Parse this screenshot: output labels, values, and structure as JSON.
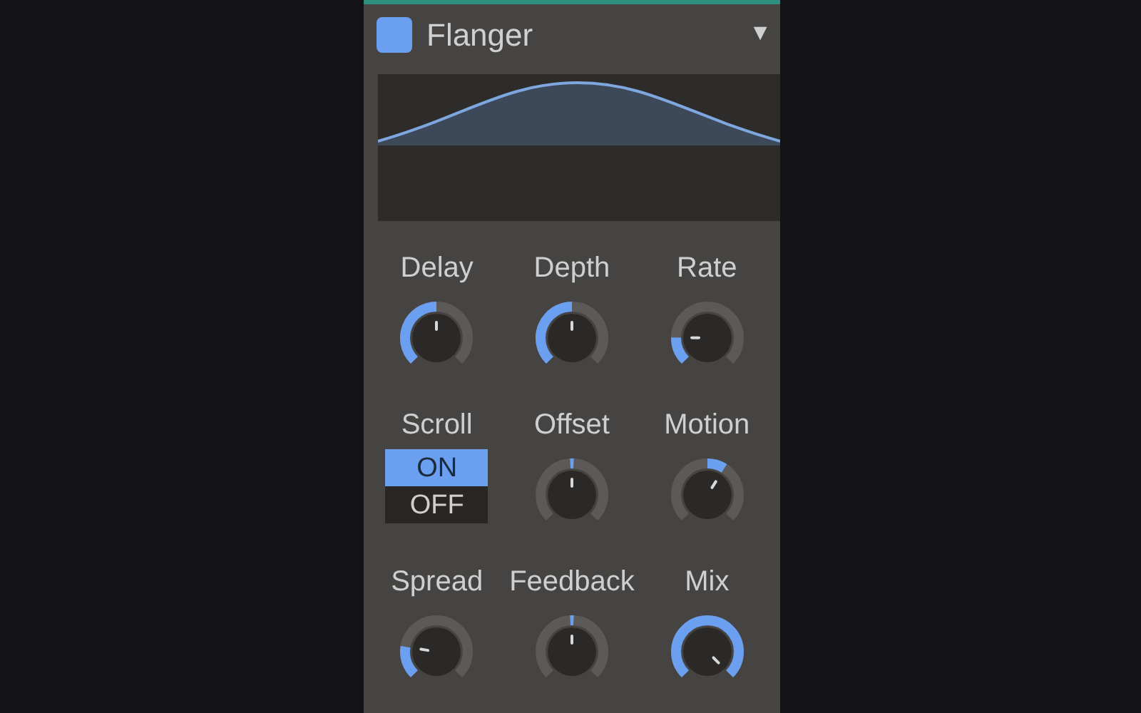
{
  "header": {
    "title": "Flanger",
    "color": "#6b9ff0",
    "menu_glyph": "▼"
  },
  "controls": [
    {
      "kind": "knob",
      "label": "Delay"
    },
    {
      "kind": "knob",
      "label": "Depth"
    },
    {
      "kind": "knob",
      "label": "Rate"
    },
    {
      "kind": "toggle",
      "label": "Scroll",
      "options": [
        {
          "label": "ON",
          "selected": true
        },
        {
          "label": "OFF",
          "selected": false
        }
      ]
    },
    {
      "kind": "knob",
      "label": "Offset"
    },
    {
      "kind": "knob",
      "label": "Motion"
    },
    {
      "kind": "knob",
      "label": "Spread"
    },
    {
      "kind": "knob",
      "label": "Feedback"
    },
    {
      "kind": "knob",
      "label": "Mix"
    }
  ]
}
